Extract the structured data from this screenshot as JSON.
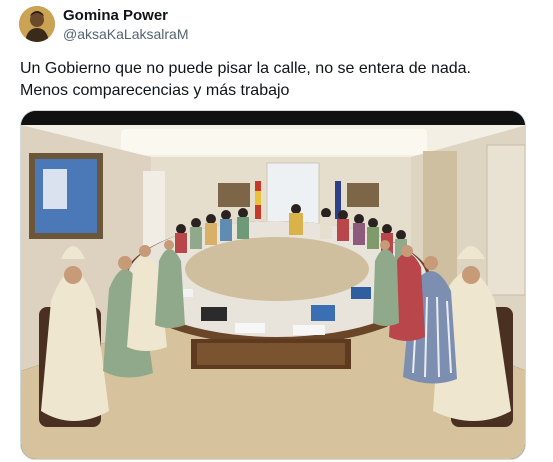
{
  "author": {
    "name": "Gomina Power",
    "handle": "@aksaKaLaksalraM",
    "avatar_icon": "profile-avatar"
  },
  "tweet": {
    "lines": [
      "Un Gobierno que no puede pisar la calle, no se entera de nada.",
      "Menos comparecencias y más trabajo"
    ]
  },
  "media": {
    "icon": "photo-council-of-ministers-meeting",
    "colors": {
      "wall": "#e9e2d3",
      "ceiling": "#f4f0e6",
      "table_top": "#e8e4dc",
      "table_wood": "#6b4527",
      "carpet": "#d9c7a3",
      "robe_cream": "#efe6d0",
      "robe_green": "#8fa98a",
      "robe_striped": "#7d8fb0",
      "robe_red": "#b9464a"
    }
  }
}
